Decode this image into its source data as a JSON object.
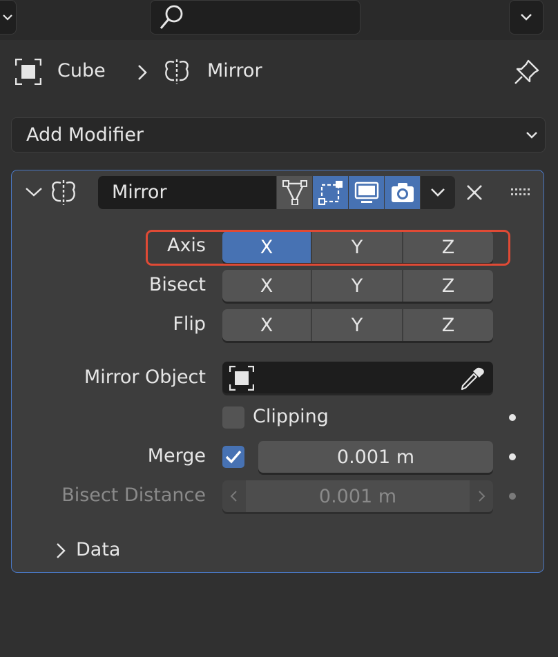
{
  "header": {
    "object_name": "Cube",
    "separator": ">",
    "modifier_name": "Mirror"
  },
  "add_modifier": {
    "label": "Add Modifier"
  },
  "modifier": {
    "name": "Mirror",
    "axis": {
      "label": "Axis",
      "options": [
        "X",
        "Y",
        "Z"
      ],
      "active": "X"
    },
    "bisect": {
      "label": "Bisect",
      "options": [
        "X",
        "Y",
        "Z"
      ]
    },
    "flip": {
      "label": "Flip",
      "options": [
        "X",
        "Y",
        "Z"
      ]
    },
    "mirror_object": {
      "label": "Mirror Object",
      "value": ""
    },
    "clipping": {
      "label": "Clipping",
      "checked": false
    },
    "merge": {
      "label": "Merge",
      "checked": true,
      "value": "0.001 m"
    },
    "bisect_distance": {
      "label": "Bisect Distance",
      "value": "0.001 m",
      "enabled": false
    },
    "data_section": {
      "label": "Data",
      "expanded": false
    }
  },
  "colors": {
    "accent": "#4772b3",
    "highlight_box": "#e04a35",
    "panel_border": "#4a78c5"
  }
}
